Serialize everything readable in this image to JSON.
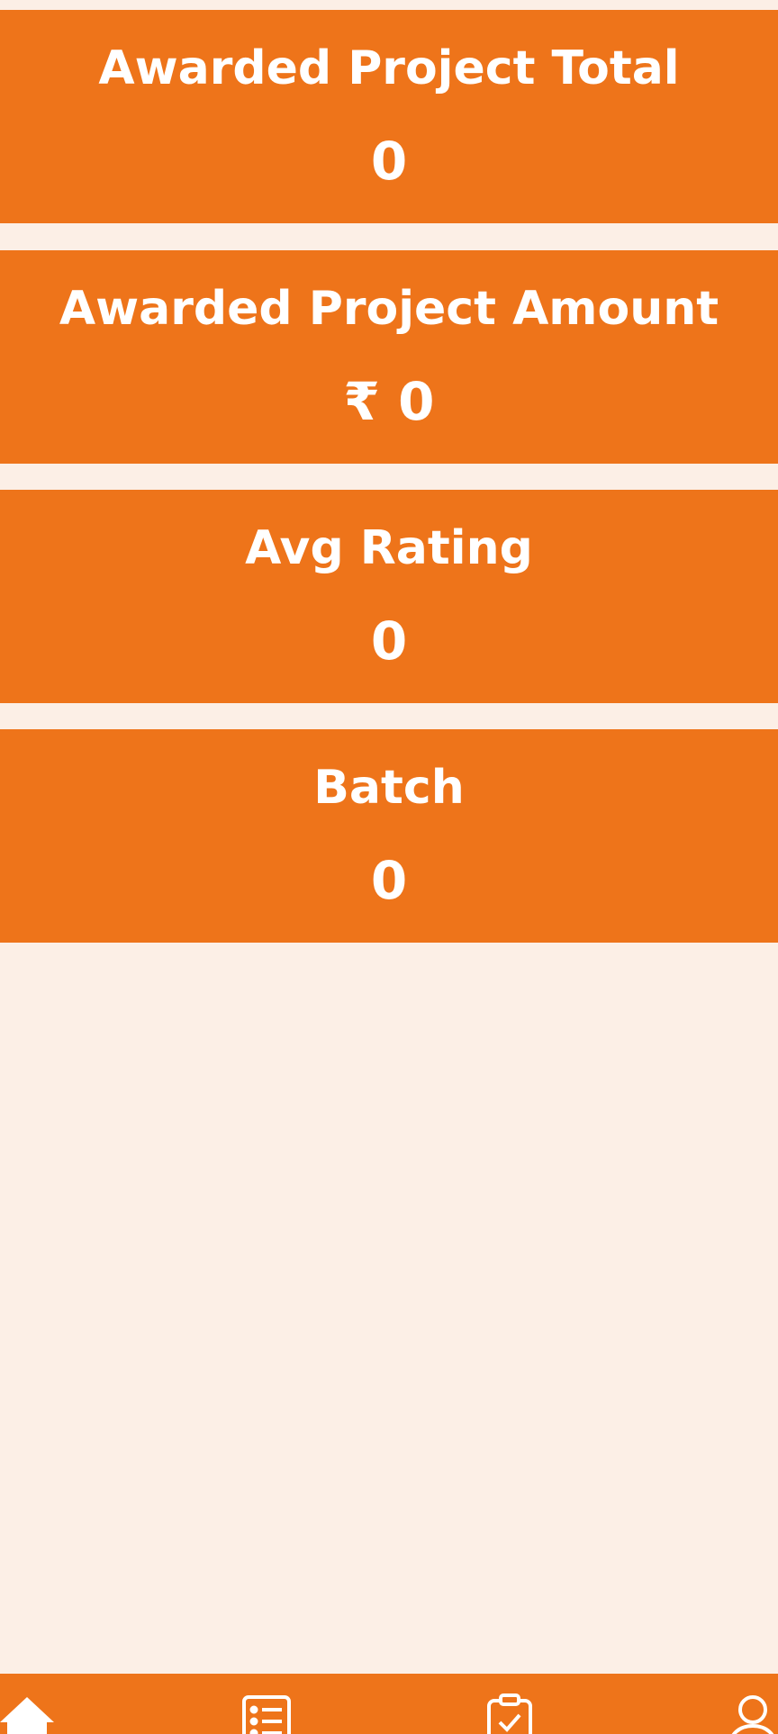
{
  "cards": [
    {
      "title": "Awarded Project Total",
      "value": "0"
    },
    {
      "title": "Awarded Project Amount",
      "value": "₹ 0"
    },
    {
      "title": "Avg Rating",
      "value": "0"
    },
    {
      "title": "Batch",
      "value": "0"
    }
  ],
  "bottom_nav": {
    "items": [
      {
        "icon": "home-icon"
      },
      {
        "icon": "list-icon"
      },
      {
        "icon": "clipboard-check-icon"
      },
      {
        "icon": "user-icon"
      }
    ]
  },
  "colors": {
    "accent": "#ee741a",
    "background": "#fcefe6",
    "text": "#ffffff"
  }
}
